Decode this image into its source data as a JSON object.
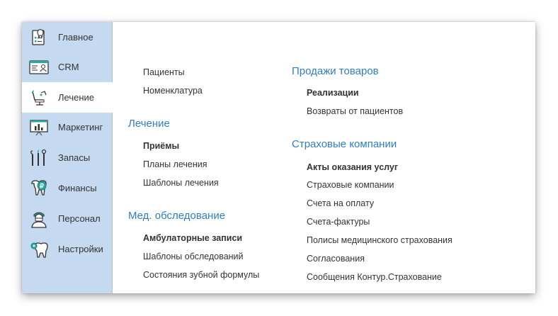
{
  "sidebar": {
    "items": [
      {
        "label": "Главное",
        "icon": "tooth-checklist-icon"
      },
      {
        "label": "CRM",
        "icon": "id-card-icon"
      },
      {
        "label": "Лечение",
        "icon": "dental-chair-icon"
      },
      {
        "label": "Маркетинг",
        "icon": "chart-board-icon"
      },
      {
        "label": "Запасы",
        "icon": "dental-tools-icon"
      },
      {
        "label": "Финансы",
        "icon": "tooth-coin-icon"
      },
      {
        "label": "Персонал",
        "icon": "doctor-icon"
      },
      {
        "label": "Настройки",
        "icon": "tooth-gear-icon"
      }
    ],
    "active": "Лечение"
  },
  "colors": {
    "sidebar_bg": "#c5d9f1",
    "section_title": "#2f7ec5"
  },
  "left_column": {
    "top_links": [
      "Пациенты",
      "Номенклатура"
    ],
    "treatment": {
      "title": "Лечение",
      "links": [
        "Приёмы",
        "Планы лечения",
        "Шаблоны лечения"
      ]
    },
    "exam": {
      "title": "Мед. обследование",
      "links": [
        "Амбулаторные записи",
        "Шаблоны обследований",
        "Состояния зубной формулы"
      ]
    }
  },
  "right_column": {
    "sales": {
      "title": "Продажи товаров",
      "links": [
        "Реализации",
        "Возвраты от пациентов"
      ]
    },
    "insurance": {
      "title": "Страховые компании",
      "links": [
        "Акты оказания услуг",
        "Страховые компании",
        "Счета на оплату",
        "Счета-фактуры",
        "Полисы медицинского страхования",
        "Согласования",
        "Сообщения Контур.Страхование"
      ]
    }
  }
}
